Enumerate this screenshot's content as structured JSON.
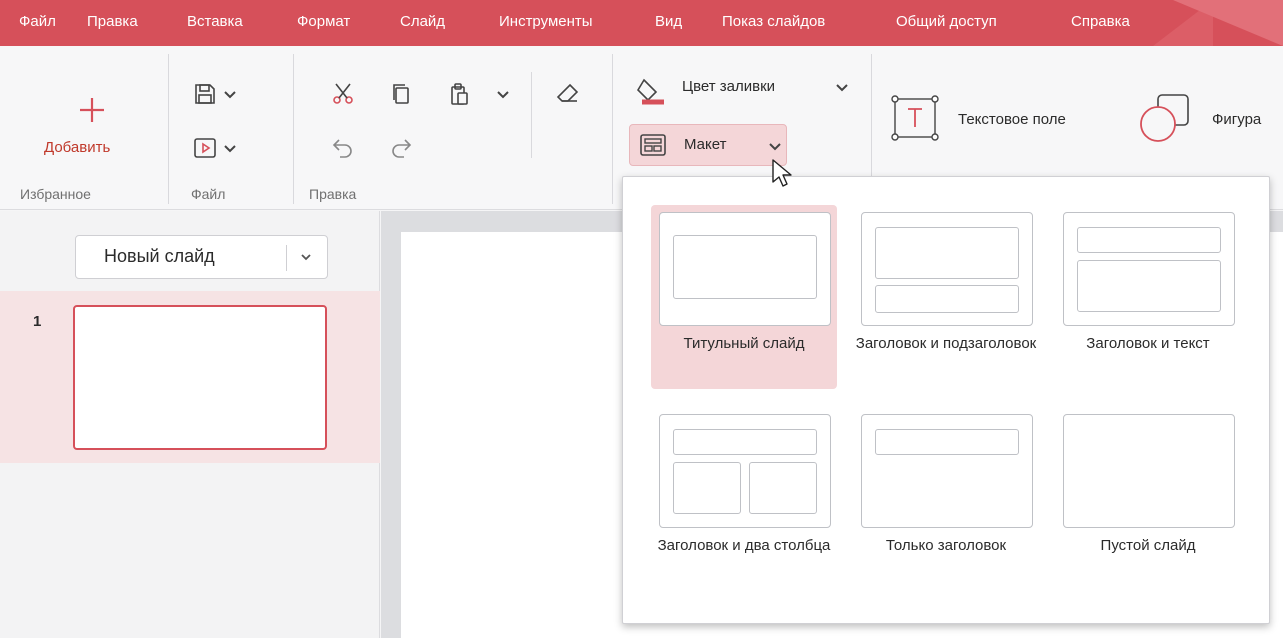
{
  "menu": {
    "items": [
      "Файл",
      "Правка",
      "Вставка",
      "Формат",
      "Слайд",
      "Инструменты",
      "Вид",
      "Показ слайдов",
      "Общий доступ",
      "Справка"
    ]
  },
  "ribbon": {
    "favorites": {
      "add_label": "Добавить",
      "group_label": "Избранное"
    },
    "file": {
      "group_label": "Файл"
    },
    "edit": {
      "group_label": "Правка"
    },
    "fill_label": "Цвет заливки",
    "layout_label": "Макет",
    "text_field_label": "Текстовое поле",
    "shape_label": "Фигура"
  },
  "slides_panel": {
    "new_slide_label": "Новый слайд",
    "slides": [
      {
        "number": "1"
      }
    ]
  },
  "layout_dropdown": {
    "tiles": [
      {
        "label": "Титульный слайд",
        "selected": true
      },
      {
        "label": "Заголовок и подзаголовок",
        "selected": false
      },
      {
        "label": "Заголовок и текст",
        "selected": false
      },
      {
        "label": "Заголовок и два столбца",
        "selected": false
      },
      {
        "label": "Только заголовок",
        "selected": false
      },
      {
        "label": "Пустой слайд",
        "selected": false
      }
    ]
  },
  "colors": {
    "accent": "#d6505a",
    "selection": "#f4d6d8",
    "add_text": "#c0392b"
  }
}
